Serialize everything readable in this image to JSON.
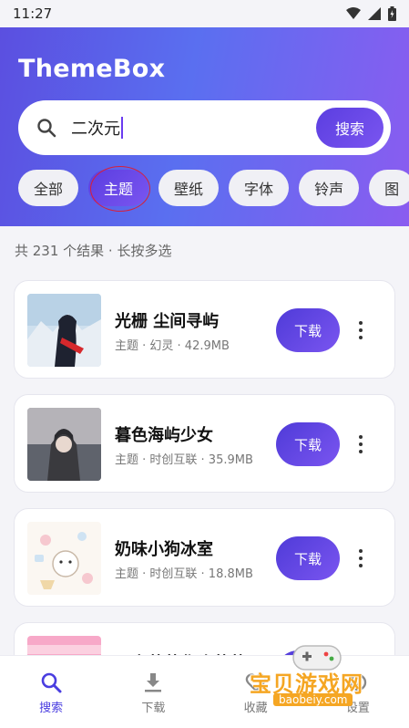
{
  "status_bar": {
    "time": "11:27"
  },
  "header": {
    "app_title": "ThemeBox",
    "search": {
      "value": "二次元",
      "button_label": "搜索"
    },
    "chips": [
      {
        "label": "全部",
        "active": false
      },
      {
        "label": "主题",
        "active": true
      },
      {
        "label": "壁纸",
        "active": false
      },
      {
        "label": "字体",
        "active": false
      },
      {
        "label": "铃声",
        "active": false
      },
      {
        "label": "图",
        "active": false
      }
    ]
  },
  "results": {
    "summary": "共 231 个结果 · 长按多选",
    "items": [
      {
        "title": "光栅 尘间寻屿",
        "meta": "主题 · 幻灵 · 42.9MB",
        "download_label": "下载"
      },
      {
        "title": "暮色海屿少女",
        "meta": "主题 · 时创互联 · 35.9MB",
        "download_label": "下载"
      },
      {
        "title": "奶味小狗冰室",
        "meta": "主题 · 时创互联 · 18.8MB",
        "download_label": "下载"
      },
      {
        "title": "二次萌萌化头萌萌",
        "meta": "",
        "download_label": "下载"
      }
    ]
  },
  "bottom_nav": [
    {
      "label": "搜索",
      "icon": "search-icon",
      "active": true
    },
    {
      "label": "下载",
      "icon": "download-icon",
      "active": false
    },
    {
      "label": "收藏",
      "icon": "heart-icon",
      "active": false
    },
    {
      "label": "设置",
      "icon": "settings-icon",
      "active": false
    }
  ],
  "watermark": {
    "text": "宝贝游戏网",
    "url": "baobeiy.com"
  },
  "colors": {
    "accent": "#5b3ee0",
    "accent_light": "#7a55f0",
    "header_start": "#5b4fe0",
    "header_end": "#8a5cf0",
    "marker": "#d81f3a"
  }
}
